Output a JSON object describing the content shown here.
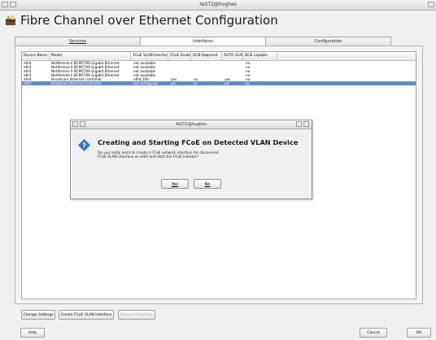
{
  "window": {
    "title": "YaST2@hughes"
  },
  "heading": {
    "title": "Fibre Channel over Ethernet Configuration",
    "icon": "fcoe-icon"
  },
  "tabs": [
    {
      "label": "Services",
      "active": false
    },
    {
      "label": "Interfaces",
      "active": true
    },
    {
      "label": "Configuration",
      "active": false
    }
  ],
  "table": {
    "columns": [
      "Device Name",
      "Model",
      "FCoE VLAN Interface",
      "FCoE Enable",
      "DCB Required",
      "AUTO VLAN",
      "DCB capable"
    ],
    "rows": [
      [
        "eth0",
        "NetXtreme II BCM5709 Gigabit Ethernet",
        "not available",
        "",
        "",
        "",
        "no"
      ],
      [
        "eth1",
        "NetXtreme II BCM5709 Gigabit Ethernet",
        "not available",
        "",
        "",
        "",
        "no"
      ],
      [
        "eth2",
        "NetXtreme II BCM5709 Gigabit Ethernet",
        "not available",
        "",
        "",
        "",
        "no"
      ],
      [
        "eth3",
        "NetXtreme II BCM5709 Gigabit Ethernet",
        "not available",
        "",
        "",
        "",
        "no"
      ],
      [
        "eth4",
        "Broadcom Ethernet controller",
        "eth4.200",
        "yes",
        "no",
        "yes",
        "no"
      ],
      [
        "eth5",
        "Broadcom Ethernet controller",
        "not configured",
        "yes",
        "no",
        "yes",
        "no"
      ]
    ],
    "selected_row": 5
  },
  "dialog": {
    "title": "YaST2@hughes",
    "heading": "Creating and Starting FCoE on Detected VLAN Device",
    "message": "Do you really want to create a FCoE network interface for discovered FCoE VLAN interface on eth5 and start the FCoE initiator?",
    "yes_label": "Yes",
    "no_label": "No",
    "icon": "question-icon"
  },
  "buttons": {
    "change_settings": "Change Settings",
    "create_vlan": "Create FCoE VLAN Interface",
    "remove_interface": "Remove Interface",
    "help": "Help",
    "cancel": "Cancel",
    "ok": "OK"
  },
  "colors": {
    "selection": "#5e8cc4",
    "accent": "#3a78c3"
  }
}
